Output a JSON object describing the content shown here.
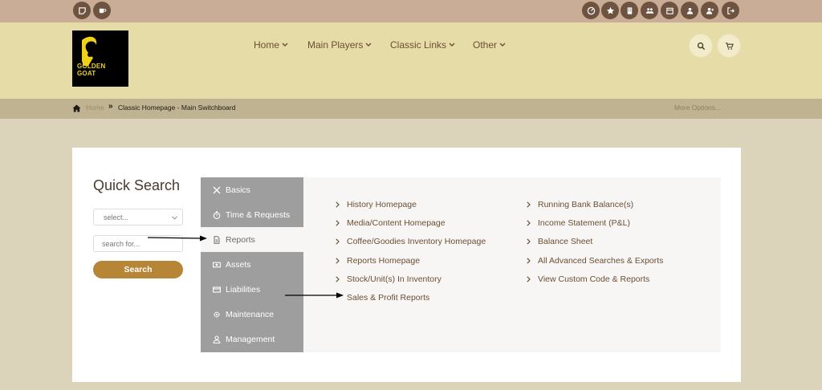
{
  "topbar": {
    "left_icons": [
      "sticky-note-icon",
      "coffee-cup-icon"
    ],
    "right_icons": [
      "dashboard-icon",
      "star-icon",
      "building-icon",
      "users-icon",
      "calendar-icon",
      "user-icon",
      "user-plus-icon",
      "sign-out-icon"
    ]
  },
  "header": {
    "logo": {
      "line1": "GOLDEN",
      "line2": "GOAT"
    },
    "nav": [
      "Home",
      "Main Players",
      "Classic Links",
      "Other"
    ],
    "icons": [
      "search-icon",
      "cart-icon"
    ]
  },
  "breadcrumb": {
    "home": "Home",
    "separator": "»",
    "current": "Classic Homepage - Main Switchboard",
    "more": "More Options..."
  },
  "quick_search": {
    "title": "Quick Search",
    "select_value": "select...",
    "input_placeholder": "search for...",
    "button": "Search"
  },
  "side_menu": [
    {
      "label": "Basics",
      "icon": "tools-icon"
    },
    {
      "label": "Time & Requests",
      "icon": "stopwatch-icon"
    },
    {
      "label": "Reports",
      "icon": "document-icon",
      "active": true
    },
    {
      "label": "Assets",
      "icon": "money-icon"
    },
    {
      "label": "Liabilities",
      "icon": "credit-card-icon"
    },
    {
      "label": "Maintenance",
      "icon": "gear-icon"
    },
    {
      "label": "Management",
      "icon": "manager-icon"
    }
  ],
  "links_col1": [
    "History Homepage",
    "Media/Content Homepage",
    "Coffee/Goodies Inventory Homepage",
    "Reports Homepage",
    "Stock/Unit(s) In Inventory",
    "Sales & Profit Reports"
  ],
  "links_col2": [
    "Running Bank Balance(s)",
    "Income Statement (P&L)",
    "Balance Sheet",
    "All Advanced Searches & Exports",
    "View Custom Code & Reports"
  ],
  "colors": {
    "topbar": "#c9ad97",
    "header": "#e6dca7",
    "crumbbar": "#c0b391",
    "accent": "#b68636",
    "menu": "#9e9e9e"
  }
}
